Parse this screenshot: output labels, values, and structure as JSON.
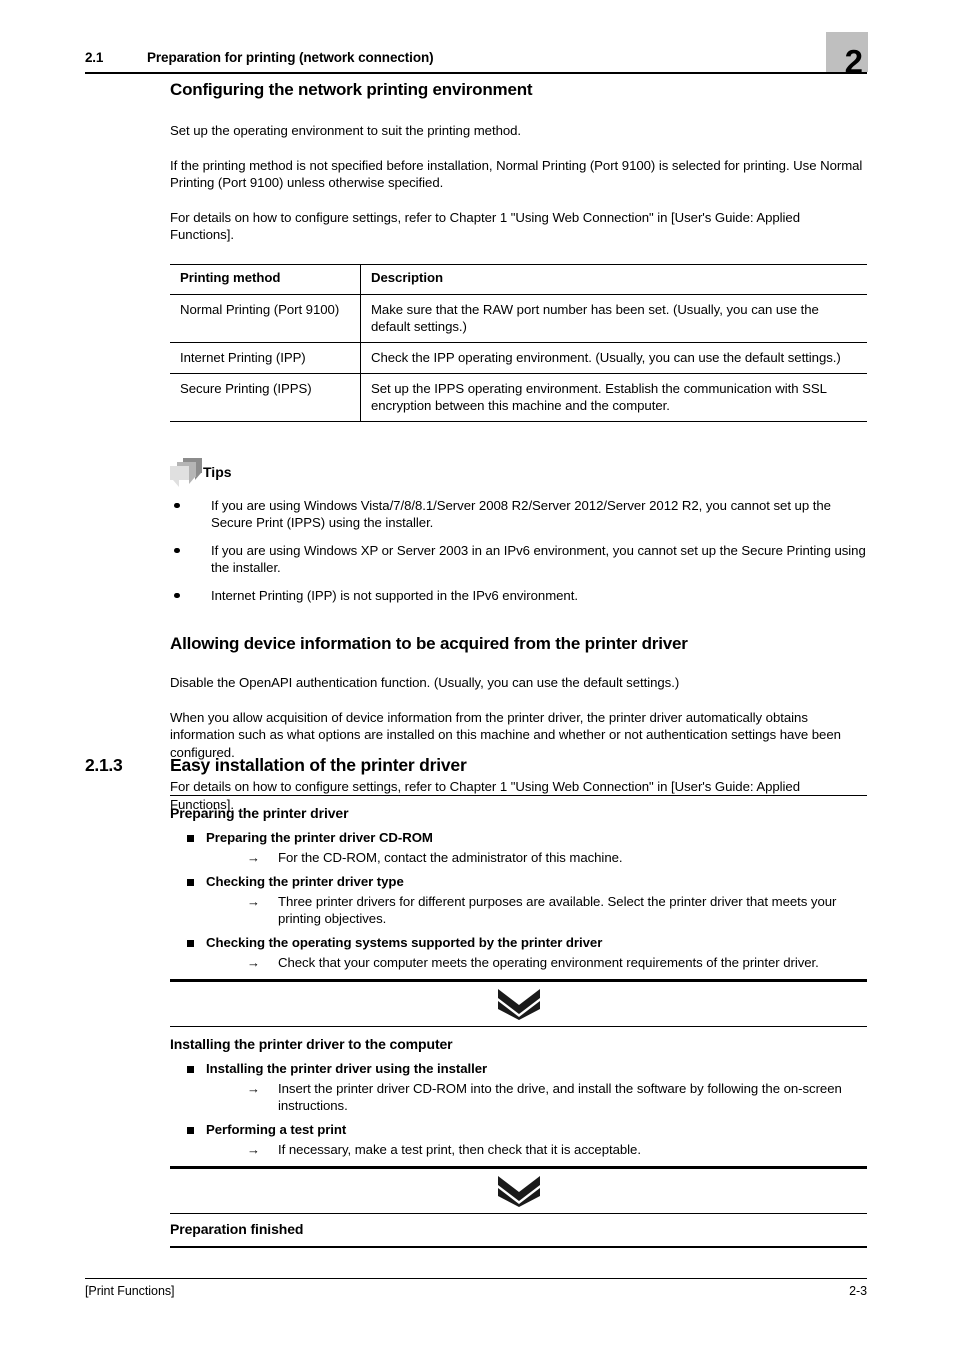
{
  "header": {
    "section_number": "2.1",
    "section_title": "Preparation for printing (network connection)",
    "chapter_number": "2"
  },
  "main": {
    "heading1": "Configuring the network printing environment",
    "para1": "Set up the operating environment to suit the printing method.",
    "para2": "If the printing method is not specified before installation, Normal Printing (Port 9100) is selected for printing. Use Normal Printing (Port 9100) unless otherwise specified.",
    "para3": "For details on how to configure settings, refer to Chapter 1 \"Using Web Connection\" in [User's Guide: Applied Functions].",
    "table": {
      "headers": [
        "Printing method",
        "Description"
      ],
      "rows": [
        {
          "method": "Normal Printing (Port 9100)",
          "description": "Make sure that the RAW port number has been set. (Usually, you can use the default settings.)"
        },
        {
          "method": "Internet Printing (IPP)",
          "description": "Check the IPP operating environment. (Usually, you can use the default settings.)"
        },
        {
          "method": "Secure Printing (IPPS)",
          "description": "Set up the IPPS operating environment. Establish the communication with SSL encryption between this machine and the computer."
        }
      ]
    },
    "tips": {
      "label": "Tips",
      "items": [
        "If you are using Windows Vista/7/8/8.1/Server 2008 R2/Server 2012/Server 2012 R2, you cannot set up the Secure Print (IPPS) using the installer.",
        "If you are using Windows XP or Server 2003 in an IPv6 environment, you cannot set up the Secure Printing using the installer.",
        "Internet Printing (IPP) is not supported in the IPv6 environment."
      ]
    },
    "heading2": "Allowing device information to be acquired from the printer driver",
    "para4": "Disable the OpenAPI authentication function. (Usually, you can use the default settings.)",
    "para5": "When you allow acquisition of device information from the printer driver, the printer driver automatically obtains information such as what options are installed on this machine and whether or not authentication settings have been configured.",
    "para6": "For details on how to configure settings, refer to Chapter 1 \"Using Web Connection\" in [User's Guide: Applied Functions]."
  },
  "section213": {
    "number": "2.1.3",
    "title": "Easy installation of the printer driver",
    "blocks": [
      {
        "title": "Preparing the printer driver",
        "items": [
          {
            "label": "Preparing the printer driver CD-ROM",
            "subitems": [
              "For the CD-ROM, contact the administrator of this machine."
            ]
          },
          {
            "label": "Checking the printer driver type",
            "subitems": [
              "Three printer drivers for different purposes are available. Select the printer driver that meets your printing objectives."
            ]
          },
          {
            "label": "Checking the operating systems supported by the printer driver",
            "subitems": [
              "Check that your computer meets the operating environment requirements of the printer driver."
            ]
          }
        ]
      },
      {
        "title": "Installing the printer driver to the computer",
        "items": [
          {
            "label": "Installing the printer driver using the installer",
            "subitems": [
              "Insert the printer driver CD-ROM into the drive, and install the software by following the on-screen instructions."
            ]
          },
          {
            "label": "Performing a test print",
            "subitems": [
              "If necessary, make a test print, then check that it is acceptable."
            ]
          }
        ]
      }
    ],
    "final_block_title": "Preparation finished",
    "arrow_glyph": "→",
    "separator_icon": "double-chevron-down-icon"
  },
  "footer": {
    "left": "[Print Functions]",
    "right": "2-3"
  },
  "colors": {
    "chapter_box_bg": "#bfbfbf",
    "rule": "#000000",
    "text": "#000000"
  }
}
